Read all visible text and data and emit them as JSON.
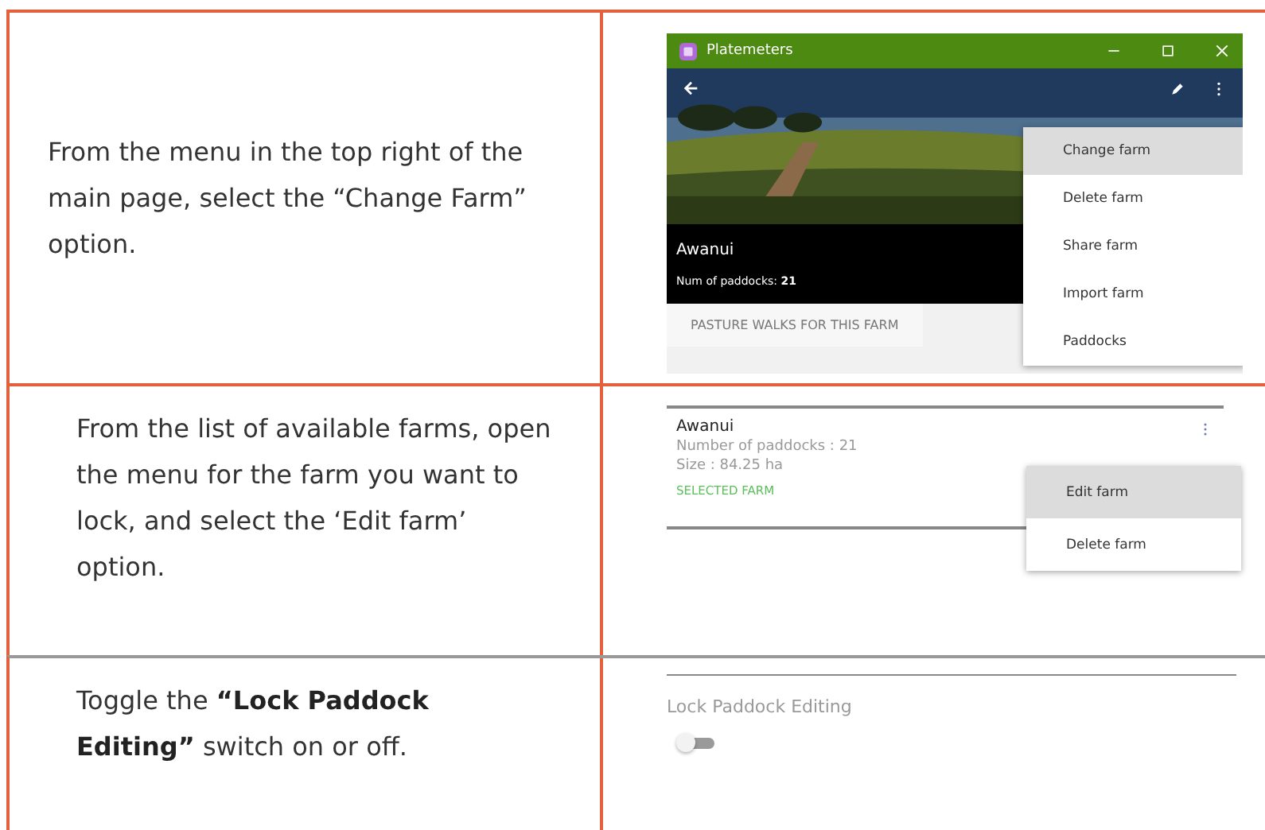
{
  "steps": [
    {
      "instruction": "From the menu in the top right of the main page, select the “Change Farm” option.",
      "screen": {
        "kind": "app-window",
        "title": "Platemeters",
        "farm_name": "Awanui",
        "paddocks": "Num of paddocks: **21**",
        "section": "PASTURE WALKS FOR THIS FARM",
        "menu": [
          {
            "label": "Change farm",
            "selected": true
          },
          {
            "label": "Delete farm",
            "selected": false
          },
          {
            "label": "Share farm",
            "selected": false
          },
          {
            "label": "Import farm",
            "selected": false
          },
          {
            "label": "Paddocks",
            "selected": false
          }
        ]
      }
    },
    {
      "instruction": "From the list of available farms, open the menu for the farm you want to lock, and select the ‘Edit farm’ option.",
      "screen": {
        "kind": "farm-card",
        "farm_name": "Awanui",
        "lines": [
          "Number of paddocks : 21",
          "Size : 84.25 ha"
        ],
        "status": "SELECTED  FARM",
        "menu": [
          {
            "label": "Edit farm",
            "selected": true
          },
          {
            "label": "Delete farm",
            "selected": false
          }
        ]
      }
    },
    {
      "instruction": "Toggle the **“Lock Paddock Editing”** switch on or off.",
      "screen": {
        "kind": "setting",
        "label": "Lock Paddock Editing",
        "on": false
      }
    }
  ]
}
